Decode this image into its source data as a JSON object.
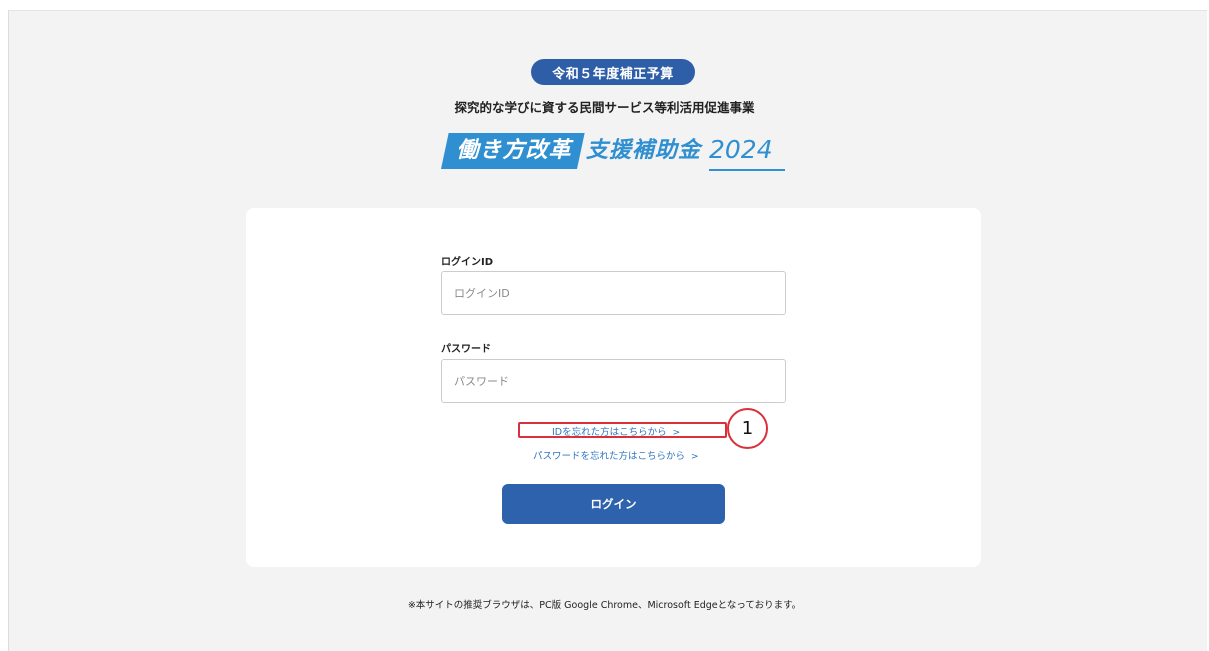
{
  "header": {
    "badge": "令和５年度補正予算",
    "subtitle": "探究的な学びに資する民間サービス等利活用促進事業",
    "logo": {
      "part1": "働き方改革",
      "part2": "支援補助金",
      "year": "2024"
    }
  },
  "form": {
    "login_id_label": "ログインID",
    "login_id_placeholder": "ログインID",
    "login_id_value": "",
    "password_label": "パスワード",
    "password_placeholder": "パスワード",
    "password_value": "",
    "forgot_id_link": "IDを忘れた方はこちらから",
    "forgot_password_link": "パスワードを忘れた方はこちらから",
    "chevron": ">",
    "login_button": "ログイン"
  },
  "annotation": {
    "callout_number": "1",
    "highlight_color": "#d9303a"
  },
  "footer": {
    "note": "※本サイトの推奨ブラウザは、PC版 Google Chrome、Microsoft Edgeとなっております。"
  },
  "colors": {
    "brand_navy": "#2f5ea8",
    "brand_blue": "#2f8fd0",
    "link": "#2f74c0",
    "button": "#2f62ad",
    "page_bg": "#f3f3f3"
  }
}
